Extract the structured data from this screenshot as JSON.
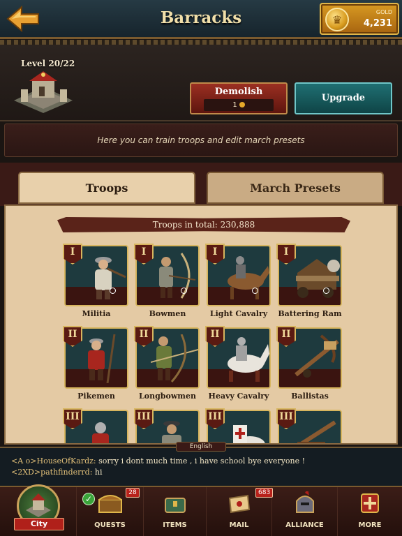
{
  "header": {
    "title": "Barracks",
    "gold_label": "GOLD",
    "gold_value": "4,231"
  },
  "building": {
    "level": "Level 20/22",
    "demolish_label": "Demolish",
    "demolish_cost": "1",
    "upgrade_label": "Upgrade",
    "info": "Here you can train troops and edit march presets"
  },
  "tabs": [
    {
      "label": "Troops",
      "active": true
    },
    {
      "label": "March Presets",
      "active": false
    }
  ],
  "troops_total": "Troops in total: 230,888",
  "troops": [
    {
      "name": "Militia",
      "tier": "I",
      "icon": "militia-icon"
    },
    {
      "name": "Bowmen",
      "tier": "I",
      "icon": "bowmen-icon"
    },
    {
      "name": "Light Cavalry",
      "tier": "I",
      "icon": "light-cavalry-icon"
    },
    {
      "name": "Battering Ram",
      "tier": "I",
      "icon": "battering-ram-icon"
    },
    {
      "name": "Pikemen",
      "tier": "II",
      "icon": "pikemen-icon"
    },
    {
      "name": "Longbowmen",
      "tier": "II",
      "icon": "longbowmen-icon"
    },
    {
      "name": "Heavy Cavalry",
      "tier": "II",
      "icon": "heavy-cavalry-icon"
    },
    {
      "name": "Ballistas",
      "tier": "II",
      "icon": "ballistas-icon"
    },
    {
      "name": "",
      "tier": "III",
      "icon": "knight-icon"
    },
    {
      "name": "",
      "tier": "III",
      "icon": "soldier-icon"
    },
    {
      "name": "",
      "tier": "III",
      "icon": "templar-cavalry-icon"
    },
    {
      "name": "",
      "tier": "III",
      "icon": "catapult-icon"
    }
  ],
  "chat": {
    "language": "English",
    "messages": [
      {
        "sender": "<A o>HouseOfKardz:",
        "text": " sorry i dont much time , i have school bye everyone !"
      },
      {
        "sender": "<2XD>pathfinderrd:",
        "text": " hi"
      }
    ]
  },
  "nav": {
    "city": "City",
    "items": [
      {
        "label": "QUESTS",
        "badge": "28"
      },
      {
        "label": "ITEMS",
        "badge": ""
      },
      {
        "label": "MAIL",
        "badge": "683"
      },
      {
        "label": "ALLIANCE",
        "badge": ""
      },
      {
        "label": "MORE",
        "badge": ""
      }
    ]
  },
  "colors": {
    "accent_gold": "#d89a22",
    "upgrade_teal": "#1f6f72",
    "demolish_red": "#9b2f22",
    "parchment": "#e4caa4"
  }
}
